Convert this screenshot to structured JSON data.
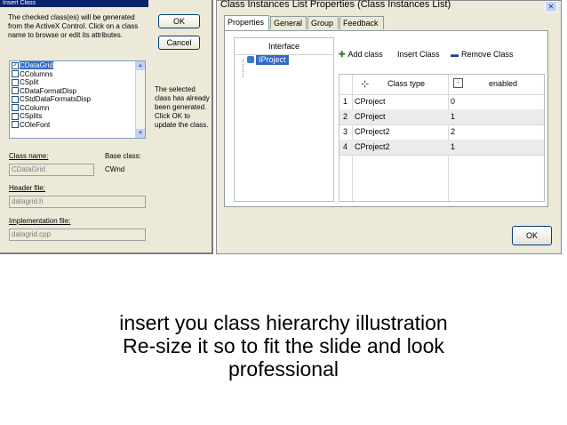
{
  "dialog1": {
    "title": "Insert Class",
    "intro": "The checked class(es) will be generated from the ActiveX Control. Click on a class name to browse or edit its attributes.",
    "ok_label": "OK",
    "cancel_label": "Cancel",
    "classes": [
      {
        "label": "CDataGrid",
        "checked": true,
        "selected": true
      },
      {
        "label": "CColumns",
        "checked": false
      },
      {
        "label": "CSplit",
        "checked": false
      },
      {
        "label": "CDataFormatDisp",
        "checked": false
      },
      {
        "label": "CStdDataFormatsDisp",
        "checked": false
      },
      {
        "label": "CColumn",
        "checked": false
      },
      {
        "label": "CSplits",
        "checked": false
      },
      {
        "label": "COleFont",
        "checked": false
      }
    ],
    "side_note": "The selected class has already been generated. Click OK to update the class.",
    "class_name_label": "Class name:",
    "class_name_value": "CDataGrid",
    "base_class_label": "Base class:",
    "base_class_value": "CWnd",
    "header_file_label": "Header file:",
    "header_file_value": "datagrid.h",
    "impl_file_label": "Implementation file:",
    "impl_file_value": "datagrid.cpp"
  },
  "dialog2": {
    "title": "Class Instances List Properties (Class Instances List)",
    "close_glyph": "✕",
    "tabs": [
      {
        "label": "Properties",
        "active": true
      },
      {
        "label": "General",
        "active": false
      },
      {
        "label": "Group",
        "active": false
      },
      {
        "label": "Feedback",
        "active": false
      }
    ],
    "interface_header": "Interface",
    "tree_item": "IProject",
    "toolbar": {
      "add_label": "Add class",
      "insert_label": "Insert Class",
      "remove_label": "Remove Class"
    },
    "grid": {
      "col_type": "Class type",
      "col_enabled": "enabled",
      "rows": [
        {
          "n": "1",
          "type": "CProject",
          "enabled": "0"
        },
        {
          "n": "2",
          "type": "CProject",
          "enabled": "1"
        },
        {
          "n": "3",
          "type": "CProject2",
          "enabled": "2"
        },
        {
          "n": "4",
          "type": "CProject2",
          "enabled": "1"
        }
      ]
    },
    "ok_label": "OK"
  },
  "caption": {
    "line1": "insert you class  hierarchy illustration",
    "line2": "Re-size it so to fit the slide and look",
    "line3": "professional"
  }
}
